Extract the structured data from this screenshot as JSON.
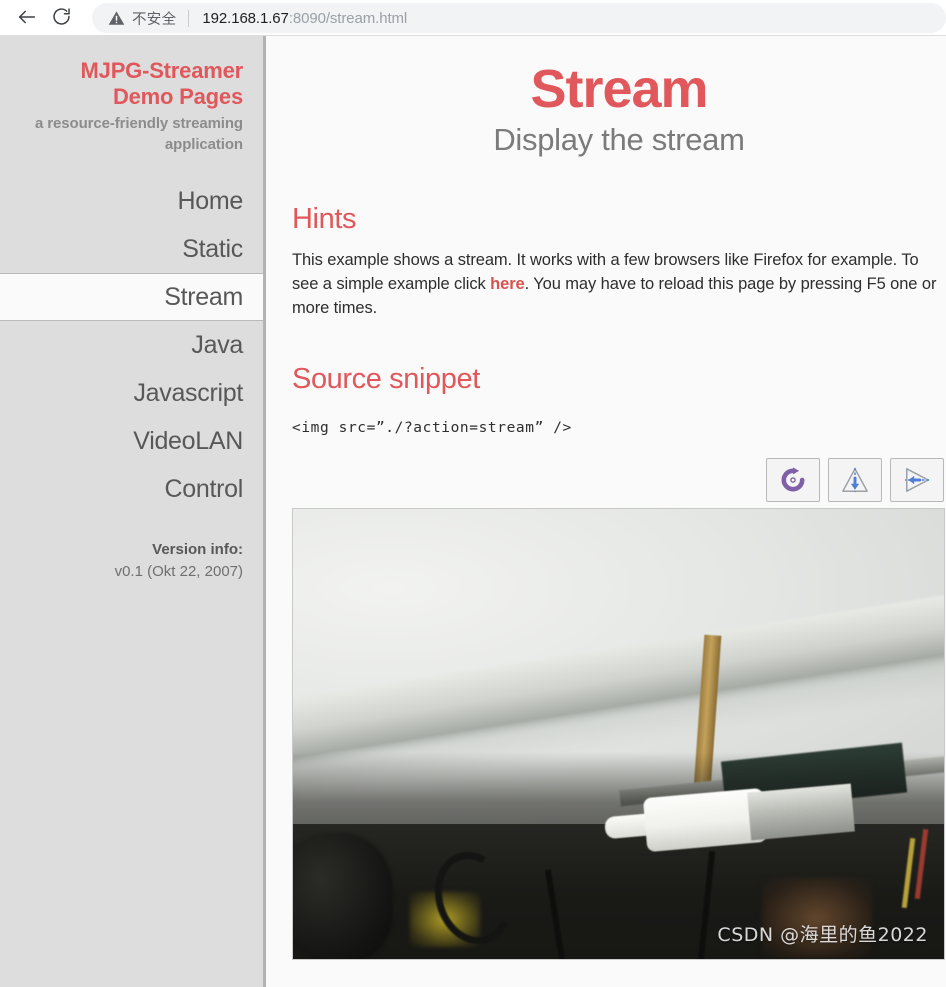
{
  "browser": {
    "back_icon": "arrow-left-icon",
    "reload_icon": "reload-icon",
    "security_icon": "warning-triangle-icon",
    "security_label": "不安全",
    "url_host": "192.168.1.67",
    "url_path": ":8090/stream.html",
    "url_full": "192.168.1.67:8090/stream.html"
  },
  "sidebar": {
    "brand_title_line1": "MJPG-Streamer",
    "brand_title_line2": "Demo Pages",
    "brand_subtitle": "a resource-friendly streaming application",
    "nav": [
      {
        "label": "Home",
        "active": false
      },
      {
        "label": "Static",
        "active": false
      },
      {
        "label": "Stream",
        "active": true
      },
      {
        "label": "Java",
        "active": false
      },
      {
        "label": "Javascript",
        "active": false
      },
      {
        "label": "VideoLAN",
        "active": false
      },
      {
        "label": "Control",
        "active": false
      }
    ],
    "version_label": "Version info:",
    "version_value": "v0.1 (Okt 22, 2007)"
  },
  "main": {
    "title": "Stream",
    "subtitle": "Display the stream",
    "hints_heading": "Hints",
    "hints_text_part1": "This example shows a stream. It works with a few browsers like Firefox for example. To see a simple example click ",
    "hints_link": "here",
    "hints_text_part2": ". You may have to reload this page by pressing F5 one or more times.",
    "snippet_heading": "Source snippet",
    "snippet_code": "<img src=”./?action=stream” />",
    "toolbar": [
      {
        "name": "rotate-icon",
        "title": "Rotate"
      },
      {
        "name": "flip-vertical-icon",
        "title": "Flip vertical"
      },
      {
        "name": "flip-horizontal-icon",
        "title": "Flip horizontal"
      }
    ],
    "stream_watermark": "CSDN @海里的鱼2022"
  },
  "colors": {
    "accent_red": "#e0585b",
    "link_red": "#d9534f",
    "sidebar_bg": "#dddddd",
    "content_bg": "#fafafa",
    "text_gray": "#585858",
    "icon_purple": "#7e5fa8",
    "icon_blue": "#4f7fd4"
  }
}
